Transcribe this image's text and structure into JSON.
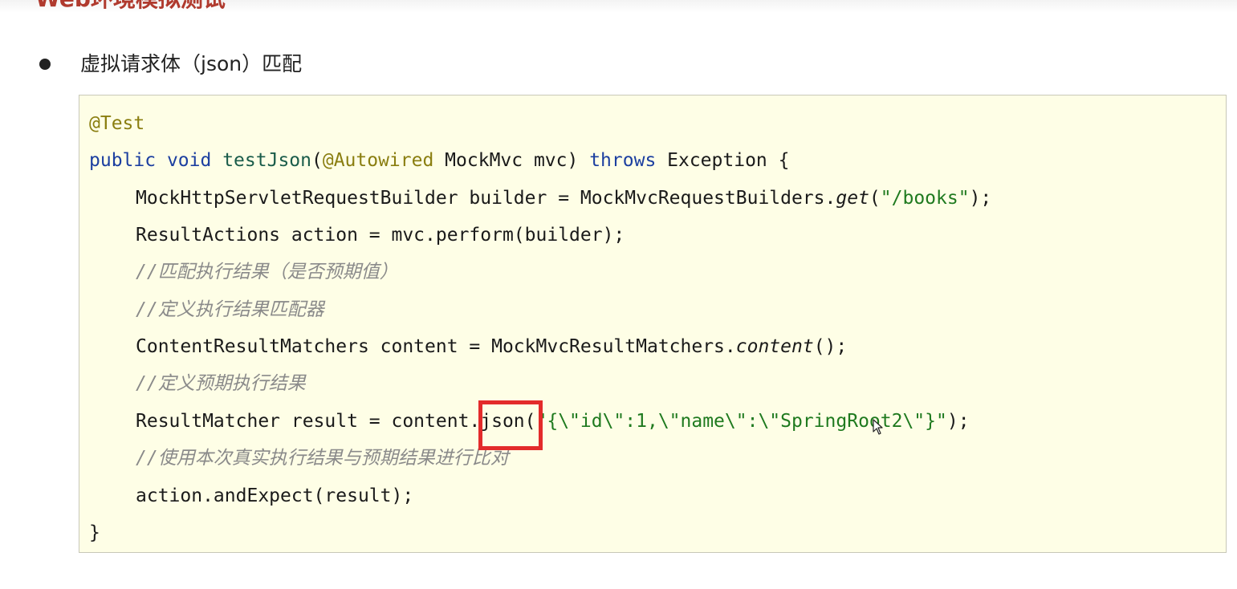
{
  "page": {
    "heading_partial": "Web环境模拟测试",
    "bullet_text": "虚拟请求体（json）匹配"
  },
  "code": {
    "line1": "@Test",
    "line2": {
      "kw1": "public",
      "kw2": "void",
      "method": "testJson",
      "annotation": "@Autowired",
      "param": " MockMvc mvc) ",
      "kw3": "throws",
      "rest": " Exception {"
    },
    "line3": {
      "pre": "MockHttpServletRequestBuilder builder = MockMvcRequestBuilders.",
      "method": "get",
      "str": "\"/books\"",
      "post": ");"
    },
    "line4": "ResultActions action = mvc.perform(builder);",
    "line5": "//匹配执行结果（是否预期值）",
    "line6": "//定义执行结果匹配器",
    "line7": {
      "pre": "ContentResultMatchers content = MockMvcResultMatchers.",
      "method": "content",
      "post": "();"
    },
    "line8": "//定义预期执行结果",
    "line9": {
      "pre": "ResultMatcher result = content.json(",
      "str": "\"{\\\"id\\\":1,\\\"name\\\":\\\"SpringRoot2\\\"}\"",
      "post": ");"
    },
    "line10": "//使用本次真实执行结果与预期结果进行比对",
    "line11": "action.andExpect(result);",
    "line12": "}"
  },
  "colors": {
    "annotation": "#8a7e10",
    "keyword": "#1c3fa0",
    "string": "#1f7a1f",
    "comment": "#8a8a8a",
    "code_background": "#fefee6",
    "highlight": "#e32b2b"
  }
}
